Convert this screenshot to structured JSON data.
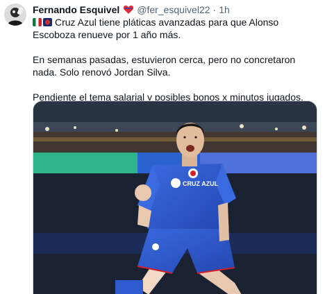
{
  "author": {
    "name": "Fernando Esquivel",
    "handle": "@fer_esquivel22",
    "separator": "·",
    "time": "1h",
    "badge_icon": "heart-badge-icon",
    "avatar_icon": "avatar-photo"
  },
  "tweet": {
    "line1_flags": [
      "mexico-flag-icon",
      "cruz-azul-flag-icon"
    ],
    "paragraph1": "Cruz Azul tiene pláticas avanzadas para que Alonso Escoboza renueve por 1 año más.",
    "paragraph2": "En semanas pasadas, estuvieron cerca, pero no concretaron nada. Solo renovó Jordan Silva.",
    "paragraph3": "Pendiente el tema salarial y posibles bonos x minutos jugados."
  },
  "media": {
    "jersey_brand": "CRUZ AZUL",
    "colors": {
      "jersey": "#2f5bd0",
      "stadium": "#1b2330",
      "accent_green": "#2ec27e"
    }
  }
}
